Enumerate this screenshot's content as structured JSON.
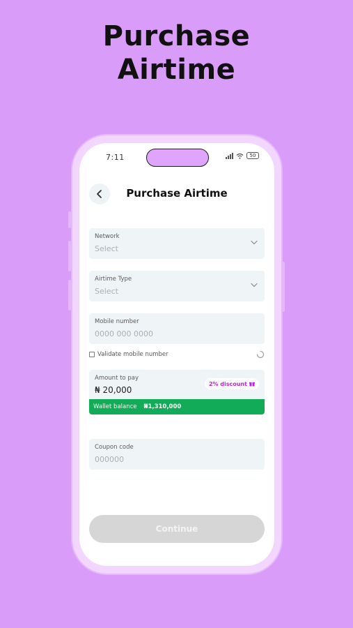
{
  "hero": {
    "line1": "Purchase",
    "line2": "Airtime"
  },
  "status_bar": {
    "time": "7:11",
    "battery": "50"
  },
  "header": {
    "title": "Purchase Airtime"
  },
  "form": {
    "network": {
      "label": "Network",
      "placeholder": "Select"
    },
    "airtime_type": {
      "label": "Airtime Type",
      "placeholder": "Select"
    },
    "mobile_number": {
      "label": "Mobile number",
      "placeholder": "0000 000 0000"
    },
    "validate": {
      "label": "Validate mobile number"
    },
    "amount": {
      "label": "Amount to pay",
      "value": "₦ 20,000",
      "discount": "2% discount",
      "wallet_label": "Wallet balance",
      "wallet_amount": "₦1,310,000"
    },
    "coupon": {
      "label": "Coupon code",
      "placeholder": "000000"
    }
  },
  "actions": {
    "continue_label": "Continue"
  },
  "colors": {
    "background": "#d99cf9",
    "wallet_bar": "#12ab57",
    "discount_text": "#b32ad1",
    "button_disabled": "#d6d6d6"
  }
}
